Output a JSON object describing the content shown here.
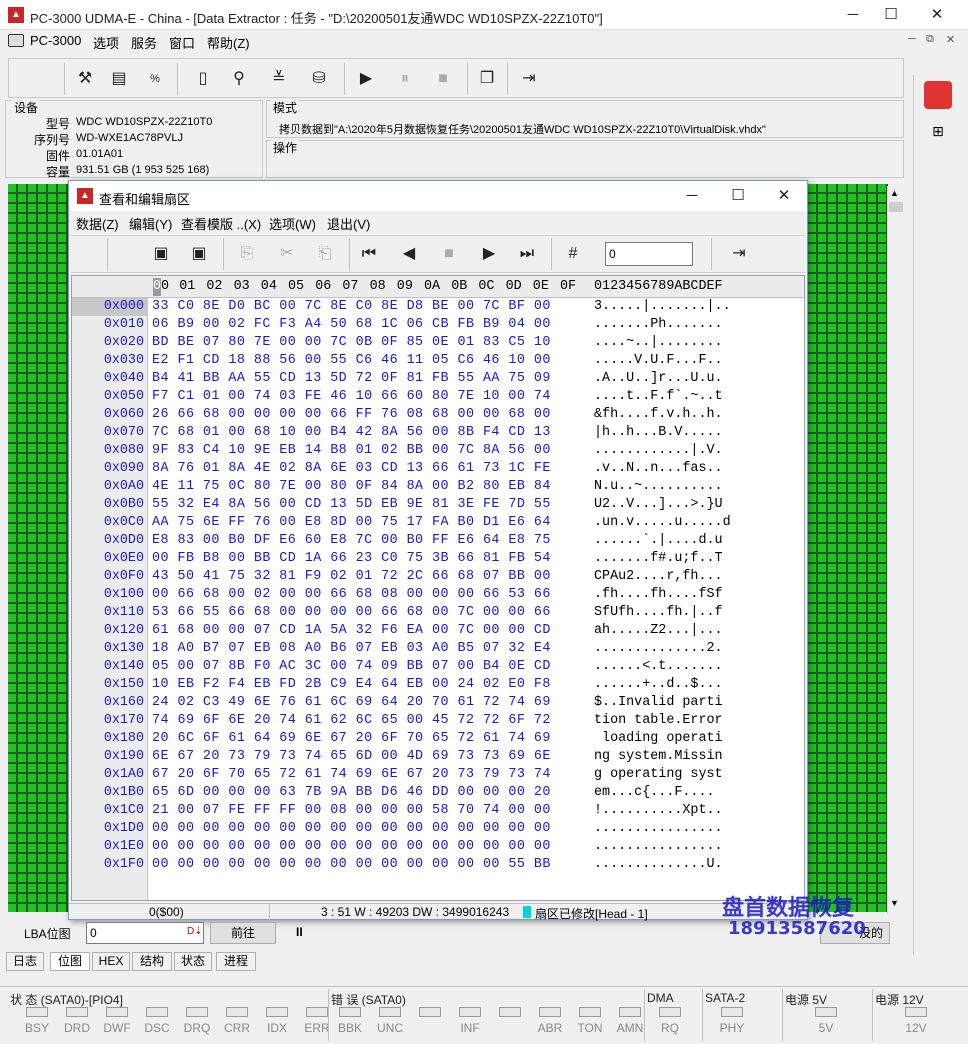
{
  "window": {
    "title": "PC-3000 UDMA-E - China - [Data Extractor : 任务 - \"D:\\20200501友通WDC WD10SPZX-22Z10T0\"]",
    "app_icon": "pc3000-logo-icon",
    "controls": [
      "─",
      "☐",
      "✕"
    ]
  },
  "menu": {
    "items": [
      "PC-3000",
      "选项",
      "服务",
      "窗口",
      "帮助(Z)"
    ],
    "mdi_controls": [
      "─",
      "⧉",
      "✕"
    ]
  },
  "device": {
    "group_label": "设备",
    "fields": [
      {
        "label": "型号",
        "value": "WDC WD10SPZX-22Z10T0"
      },
      {
        "label": "序列号",
        "value": "WD-WXE1AC78PVLJ"
      },
      {
        "label": "固件",
        "value": "01.01A01"
      },
      {
        "label": "容量",
        "value": "931.51 GB (1 953 525 168)"
      }
    ]
  },
  "mode": {
    "group_label": "模式",
    "text": "拷贝数据到\"A:\\2020年5月数据恢复任务\\20200501友通WDC WD10SPZX-22Z10T0\\VirtualDisk.vhdx\""
  },
  "operation": {
    "group_label": "操作"
  },
  "dialog": {
    "title": "查看和编辑扇区",
    "menu": [
      "数据(Z)",
      "编辑(Y)",
      "查看模版 ..(X)",
      "选项(W)",
      "退出(V)"
    ],
    "goto_value": "0",
    "header": {
      "cursor": "0",
      "columns": [
        "0",
        "01",
        "02",
        "03",
        "04",
        "05",
        "06",
        "07",
        "08",
        "09",
        "0A",
        "0B",
        "0C",
        "0D",
        "0E",
        "0F"
      ],
      "ascii": "0123456789ABCDEF"
    },
    "rows": [
      {
        "off": "0x000",
        "hex": "33 C0 8E D0 BC 00 7C 8E C0 8E D8 BE 00 7C BF 00",
        "ascii": "3.....|.......|.."
      },
      {
        "off": "0x010",
        "hex": "06 B9 00 02 FC F3 A4 50 68 1C 06 CB FB B9 04 00",
        "ascii": ".......Ph......."
      },
      {
        "off": "0x020",
        "hex": "BD BE 07 80 7E 00 00 7C 0B 0F 85 0E 01 83 C5 10",
        "ascii": "....~..|........"
      },
      {
        "off": "0x030",
        "hex": "E2 F1 CD 18 88 56 00 55 C6 46 11 05 C6 46 10 00",
        "ascii": ".....V.U.F...F.."
      },
      {
        "off": "0x040",
        "hex": "B4 41 BB AA 55 CD 13 5D 72 0F 81 FB 55 AA 75 09",
        "ascii": ".A..U..]r...U.u."
      },
      {
        "off": "0x050",
        "hex": "F7 C1 01 00 74 03 FE 46 10 66 60 80 7E 10 00 74",
        "ascii": "....t..F.f`.~..t"
      },
      {
        "off": "0x060",
        "hex": "26 66 68 00 00 00 00 66 FF 76 08 68 00 00 68 00",
        "ascii": "&fh....f.v.h..h."
      },
      {
        "off": "0x070",
        "hex": "7C 68 01 00 68 10 00 B4 42 8A 56 00 8B F4 CD 13",
        "ascii": "|h..h...B.V....."
      },
      {
        "off": "0x080",
        "hex": "9F 83 C4 10 9E EB 14 B8 01 02 BB 00 7C 8A 56 00",
        "ascii": "............|.V."
      },
      {
        "off": "0x090",
        "hex": "8A 76 01 8A 4E 02 8A 6E 03 CD 13 66 61 73 1C FE",
        "ascii": ".v..N..n...fas.."
      },
      {
        "off": "0x0A0",
        "hex": "4E 11 75 0C 80 7E 00 80 0F 84 8A 00 B2 80 EB 84",
        "ascii": "N.u..~.........."
      },
      {
        "off": "0x0B0",
        "hex": "55 32 E4 8A 56 00 CD 13 5D EB 9E 81 3E FE 7D 55",
        "ascii": "U2..V...]...>.}U"
      },
      {
        "off": "0x0C0",
        "hex": "AA 75 6E FF 76 00 E8 8D 00 75 17 FA B0 D1 E6 64",
        "ascii": ".un.v.....u.....d"
      },
      {
        "off": "0x0D0",
        "hex": "E8 83 00 B0 DF E6 60 E8 7C 00 B0 FF E6 64 E8 75",
        "ascii": "......`.|....d.u"
      },
      {
        "off": "0x0E0",
        "hex": "00 FB B8 00 BB CD 1A 66 23 C0 75 3B 66 81 FB 54",
        "ascii": ".......f#.u;f..T"
      },
      {
        "off": "0x0F0",
        "hex": "43 50 41 75 32 81 F9 02 01 72 2C 66 68 07 BB 00",
        "ascii": "CPAu2....r,fh..."
      },
      {
        "off": "0x100",
        "hex": "00 66 68 00 02 00 00 66 68 08 00 00 00 66 53 66",
        "ascii": ".fh....fh....fSf"
      },
      {
        "off": "0x110",
        "hex": "53 66 55 66 68 00 00 00 00 66 68 00 7C 00 00 66",
        "ascii": "SfUfh....fh.|..f"
      },
      {
        "off": "0x120",
        "hex": "61 68 00 00 07 CD 1A 5A 32 F6 EA 00 7C 00 00 CD",
        "ascii": "ah.....Z2...|..."
      },
      {
        "off": "0x130",
        "hex": "18 A0 B7 07 EB 08 A0 B6 07 EB 03 A0 B5 07 32 E4",
        "ascii": "..............2."
      },
      {
        "off": "0x140",
        "hex": "05 00 07 8B F0 AC 3C 00 74 09 BB 07 00 B4 0E CD",
        "ascii": "......<.t......."
      },
      {
        "off": "0x150",
        "hex": "10 EB F2 F4 EB FD 2B C9 E4 64 EB 00 24 02 E0 F8",
        "ascii": "......+..d..$..."
      },
      {
        "off": "0x160",
        "hex": "24 02 C3 49 6E 76 61 6C 69 64 20 70 61 72 74 69",
        "ascii": "$..Invalid parti"
      },
      {
        "off": "0x170",
        "hex": "74 69 6F 6E 20 74 61 62 6C 65 00 45 72 72 6F 72",
        "ascii": "tion table.Error"
      },
      {
        "off": "0x180",
        "hex": "20 6C 6F 61 64 69 6E 67 20 6F 70 65 72 61 74 69",
        "ascii": " loading operati"
      },
      {
        "off": "0x190",
        "hex": "6E 67 20 73 79 73 74 65 6D 00 4D 69 73 73 69 6E",
        "ascii": "ng system.Missin"
      },
      {
        "off": "0x1A0",
        "hex": "67 20 6F 70 65 72 61 74 69 6E 67 20 73 79 73 74",
        "ascii": "g operating syst"
      },
      {
        "off": "0x1B0",
        "hex": "65 6D 00 00 00 63 7B 9A BB D6 46 DD 00 00 00 20",
        "ascii": "em...c{...F...."
      },
      {
        "off": "0x1C0",
        "hex": "21 00 07 FE FF FF 00 08 00 00 00 58 70 74 00 00",
        "ascii": "!..........Xpt.."
      },
      {
        "off": "0x1D0",
        "hex": "00 00 00 00 00 00 00 00 00 00 00 00 00 00 00 00",
        "ascii": "................"
      },
      {
        "off": "0x1E0",
        "hex": "00 00 00 00 00 00 00 00 00 00 00 00 00 00 00 00",
        "ascii": "................"
      },
      {
        "off": "0x1F0",
        "hex": "00 00 00 00 00 00 00 00 00 00 00 00 00 00 55 BB",
        "ascii": "..............U."
      }
    ],
    "status": {
      "position": "0($00)",
      "word_info": "3 : 51 W : 49203 DW : 3499016243",
      "modified": "扇区已修改[Head - 1]"
    }
  },
  "lba": {
    "label": "LBA位图",
    "value": "0",
    "goto_label": "前往",
    "pause": "II",
    "hidden_button_tail": "没的"
  },
  "bottom_tabs": [
    "日志",
    "位图",
    "HEX",
    "结构",
    "状态",
    "进程"
  ],
  "active_tab": "位图",
  "watermark": {
    "line1": "盘首数据恢复",
    "line2": "18913587620"
  },
  "statusbar": {
    "groups": [
      {
        "title": "状 态 (SATA0)-[PIO4]",
        "leds": [
          "BSY",
          "DRD",
          "DWF",
          "DSC",
          "DRQ",
          "CRR",
          "IDX",
          "ERR"
        ]
      },
      {
        "title": "错 误 (SATA0)",
        "leds": [
          "BBK",
          "UNC",
          "",
          "INF",
          "",
          "ABR",
          "TON",
          "AMN"
        ]
      },
      {
        "title": "DMA",
        "leds": [
          "RQ"
        ]
      },
      {
        "title": "SATA-2",
        "leds": [
          "PHY"
        ]
      },
      {
        "title": "电源 5V",
        "leds": [
          "5V"
        ]
      },
      {
        "title": "电源 12V",
        "leds": [
          "12V"
        ]
      }
    ]
  },
  "colors": {
    "hex_text": "#1a1ac8",
    "block_green": "#22c022",
    "modified_marker": "#00d8d8",
    "watermark": "#1a1ac8"
  }
}
